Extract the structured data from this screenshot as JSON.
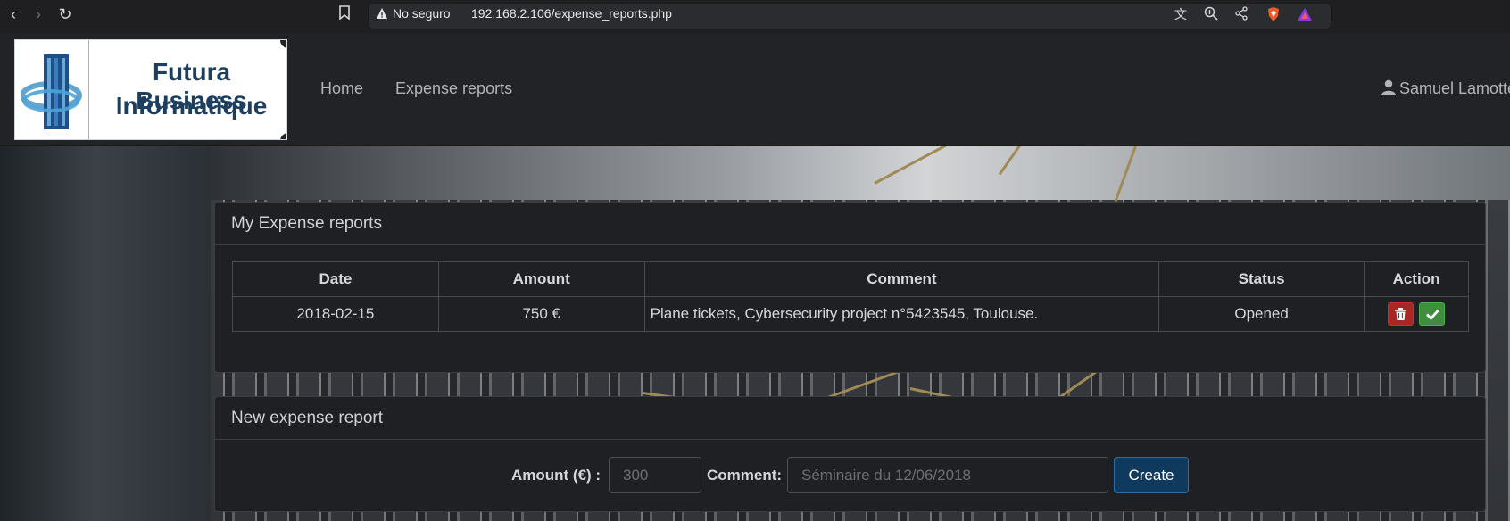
{
  "browser": {
    "security_label": "No seguro",
    "url": "192.168.2.106/expense_reports.php"
  },
  "header": {
    "logo_line1": "Futura Business",
    "logo_line2": "Informatique",
    "nav": [
      {
        "label": "Home"
      },
      {
        "label": "Expense reports"
      }
    ],
    "user_name": "Samuel Lamotte"
  },
  "reports_panel": {
    "title": "My Expense reports",
    "columns": [
      "Date",
      "Amount",
      "Comment",
      "Status",
      "Action"
    ],
    "rows": [
      {
        "date": "2018-02-15",
        "amount": "750 €",
        "comment": "Plane tickets, Cybersecurity project n°5423545, Toulouse.",
        "status": "Opened"
      }
    ]
  },
  "new_report_panel": {
    "title": "New expense report",
    "amount_label": "Amount (€) :",
    "amount_placeholder": "300",
    "comment_label": "Comment:",
    "comment_placeholder": "Séminaire du 12/06/2018",
    "create_label": "Create"
  },
  "colors": {
    "delete": "#a92825",
    "validate": "#3f8d3f",
    "create": "#0f3a5e"
  }
}
